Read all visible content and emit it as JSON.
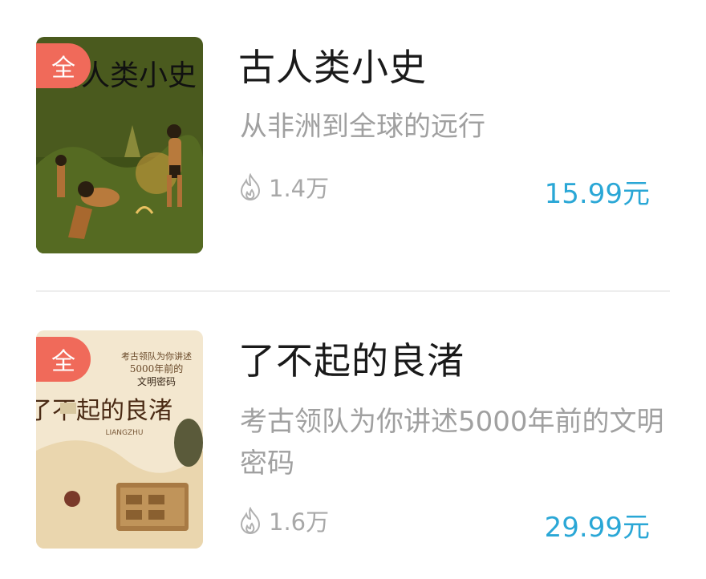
{
  "books": [
    {
      "badge": "全",
      "cover_title": "古人类小史",
      "cover_subtitle": "从非洲到全球的远行",
      "title": "古人类小史",
      "subtitle": "从非洲到全球的远行",
      "heat": "1.4万",
      "price": "15.99元"
    },
    {
      "badge": "全",
      "cover_title": "了不起的良渚",
      "cover_tagline_1": "考古领队为你讲述",
      "cover_tagline_2": "5000年前的",
      "cover_tagline_3": "文明密码",
      "cover_latin": "LIANGZHU",
      "title": "了不起的良渚",
      "subtitle": "考古领队为你讲述5000年前的文明密码",
      "heat": "1.6万",
      "price": "29.99元"
    }
  ],
  "icons": {
    "heat": "flame-icon"
  },
  "colors": {
    "badge": "#f06a5a",
    "price": "#2aa7d6",
    "muted": "#a0a0a0"
  }
}
